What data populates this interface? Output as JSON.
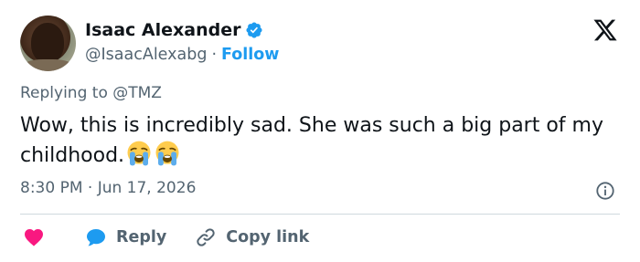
{
  "author": {
    "display_name": "Isaac Alexander",
    "handle": "@IsaacAlexabg",
    "separator": "·",
    "follow_label": "Follow",
    "verified": true
  },
  "tweet": {
    "replying_to_label": "Replying to",
    "replying_to_handle": "@TMZ",
    "text": "Wow, this is incredibly sad. She was such a big part of my childhood.",
    "emojis": [
      "loudly-crying-face",
      "loudly-crying-face"
    ],
    "timestamp": "8:30 PM · Jun 17, 2026"
  },
  "actions": {
    "like_icon": "heart-icon",
    "reply_label": "Reply",
    "copy_link_label": "Copy link"
  },
  "colors": {
    "accent": "#1d9bf0",
    "like": "#f91880",
    "text": "#0f1419",
    "muted": "#536471",
    "divider": "#cfd9de"
  }
}
